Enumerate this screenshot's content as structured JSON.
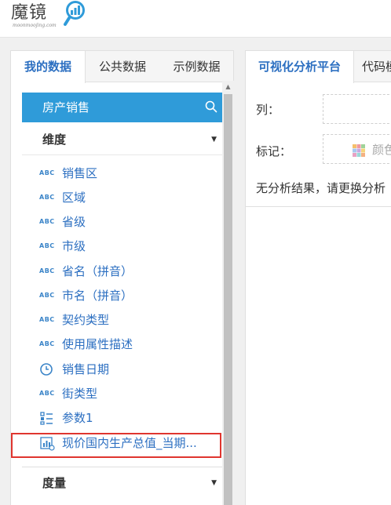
{
  "header": {
    "logo_text": "魔镜",
    "logo_sub": "moonmoojing.com"
  },
  "left_panel": {
    "tabs": [
      {
        "label": "我的数据",
        "active": true
      },
      {
        "label": "公共数据",
        "active": false
      },
      {
        "label": "示例数据",
        "active": false
      }
    ],
    "dataset_name": "房产销售",
    "dimensions": {
      "label": "维度",
      "fields": [
        {
          "label": "销售区",
          "type": "abc"
        },
        {
          "label": "区域",
          "type": "abc"
        },
        {
          "label": "省级",
          "type": "abc"
        },
        {
          "label": "市级",
          "type": "abc"
        },
        {
          "label": "省名（拼音）",
          "type": "abc"
        },
        {
          "label": "市名（拼音）",
          "type": "abc"
        },
        {
          "label": "契约类型",
          "type": "abc"
        },
        {
          "label": "使用属性描述",
          "type": "abc"
        },
        {
          "label": "销售日期",
          "type": "date"
        },
        {
          "label": "街类型",
          "type": "abc"
        },
        {
          "label": "参数1",
          "type": "param"
        },
        {
          "label": "现价国内生产总值_当期...",
          "type": "calc"
        }
      ],
      "type_badge": "ABC"
    },
    "measures": {
      "label": "度量"
    }
  },
  "right_panel": {
    "tabs": [
      {
        "label": "可视化分析平台",
        "active": true
      },
      {
        "label": "代码模",
        "active": false
      }
    ],
    "columns_label": "列：",
    "marks_label": "标记：",
    "color_label": "颜色",
    "no_result": "无分析结果，请更换分析"
  },
  "colors": {
    "accent": "#2f9bd9",
    "link": "#2c6fc1",
    "highlight": "#e0352f"
  }
}
